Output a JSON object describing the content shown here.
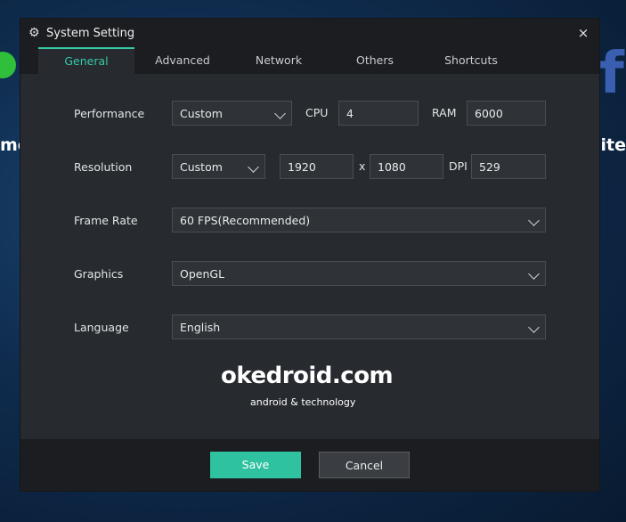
{
  "background": {
    "left_text": "me",
    "right_text": "ite",
    "right_logo": "f"
  },
  "dialog": {
    "title": "System Setting",
    "title_icon": "gear-icon",
    "close_icon": "×"
  },
  "tabs": [
    {
      "label": "General",
      "active": true
    },
    {
      "label": "Advanced",
      "active": false
    },
    {
      "label": "Network",
      "active": false
    },
    {
      "label": "Others",
      "active": false
    },
    {
      "label": "Shortcuts",
      "active": false
    }
  ],
  "performance": {
    "label": "Performance",
    "mode": "Custom",
    "cpu_label": "CPU",
    "cpu_value": "4",
    "ram_label": "RAM",
    "ram_value": "6000"
  },
  "resolution": {
    "label": "Resolution",
    "mode": "Custom",
    "width": "1920",
    "separator": "x",
    "height": "1080",
    "dpi_label": "DPI",
    "dpi_value": "529"
  },
  "frame_rate": {
    "label": "Frame Rate",
    "value": "60 FPS(Recommended)"
  },
  "graphics": {
    "label": "Graphics",
    "value": "OpenGL"
  },
  "language": {
    "label": "Language",
    "value": "English"
  },
  "watermark": {
    "main": "okedroid.com",
    "sub": "android & technology"
  },
  "footer": {
    "save_label": "Save",
    "cancel_label": "Cancel"
  },
  "colors": {
    "accent": "#2ec2a0",
    "dialog_bg": "#272b2f",
    "titlebar_bg": "#1b1d20"
  }
}
